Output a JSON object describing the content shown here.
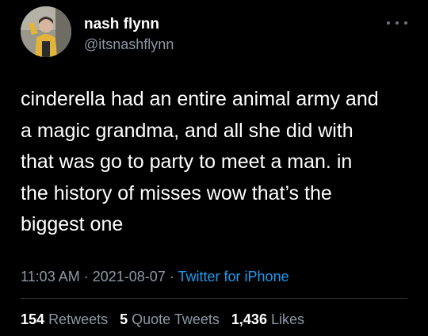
{
  "user": {
    "display_name": "nash flynn",
    "handle": "@itsnashflynn",
    "avatar_icon": "profile-photo"
  },
  "tweet": {
    "lines": [
      "cinderella had an entire animal army and",
      "a magic grandma, and all she did with",
      "that was go to party to meet a man. in",
      "the history of misses wow that’s the",
      "biggest one"
    ]
  },
  "meta": {
    "time": "11:03 AM",
    "separator": "·",
    "date": "2021-08-07",
    "source": "Twitter for iPhone"
  },
  "stats": {
    "retweets_count": "154",
    "retweets_label": "Retweets",
    "quotes_count": "5",
    "quotes_label": "Quote Tweets",
    "likes_count": "1,436",
    "likes_label": "Likes"
  },
  "colors": {
    "background": "#000000",
    "text": "#ffffff",
    "secondary": "#8b98a5",
    "link": "#1d9bf0"
  }
}
